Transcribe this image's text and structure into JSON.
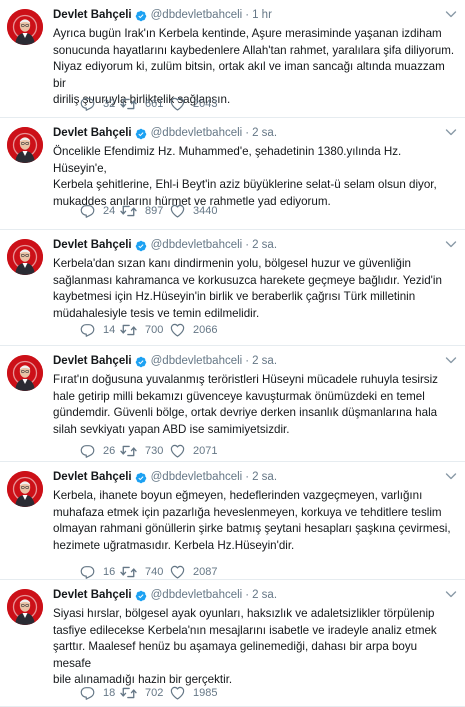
{
  "tweets": [
    {
      "name": "Devlet Bahçeli",
      "handle": "@dbdevletbahceli",
      "dot": "·",
      "time": "1 hr",
      "text": "Ayrıca bugün Irak'ın Kerbela kentinde, Aşure merasiminde yaşanan izdiham\nsonucunda hayatlarını kaybedenlere Allah'tan rahmet, yaralılara şifa diliyorum.\nNiyaz ediyorum ki, zulüm bitsin, ortak akıl ve iman sancağı altında muazzam bir\ndiriliş şuuruyla birliktelik sağlansın.",
      "replies": "32",
      "retweets": "661",
      "likes": "2043"
    },
    {
      "name": "Devlet Bahçeli",
      "handle": "@dbdevletbahceli",
      "dot": "·",
      "time": "2 sa.",
      "text": "Öncelikle Efendimiz Hz. Muhammed'e, şehadetinin 1380.yılında Hz. Hüseyin'e,\nKerbela şehitlerine, Ehl-i Beyt'in aziz büyüklerine selat-ü selam olsun diyor,\nmukaddes anılarını hürmet ve rahmetle yad ediyorum.",
      "replies": "24",
      "retweets": "897",
      "likes": "3440"
    },
    {
      "name": "Devlet Bahçeli",
      "handle": "@dbdevletbahceli",
      "dot": "·",
      "time": "2 sa.",
      "text": "Kerbela'dan sızan kanı dindirmenin yolu, bölgesel huzur ve güvenliğin\nsağlanması kahramanca ve korkusuzca harekete geçmeye bağlıdır. Yezid'in\nkaybetmesi için Hz.Hüseyin'in birlik ve beraberlik çağrısı Türk milletinin\nmüdahalesiyle tesis ve temin edilmelidir.",
      "replies": "14",
      "retweets": "700",
      "likes": "2066"
    },
    {
      "name": "Devlet Bahçeli",
      "handle": "@dbdevletbahceli",
      "dot": "·",
      "time": "2 sa.",
      "text": "Fırat'ın doğusuna yuvalanmış teröristleri Hüseyni mücadele ruhuyla tesirsiz\nhale getirip milli bekamızı güvenceye kavuşturmak önümüzdeki en temel\ngündemdir. Güvenli bölge, ortak devriye derken insanlık düşmanlarına hala\nsilah sevkiyatı yapan ABD ise samimiyetsizdir.",
      "replies": "26",
      "retweets": "730",
      "likes": "2071"
    },
    {
      "name": "Devlet Bahçeli",
      "handle": "@dbdevletbahceli",
      "dot": "·",
      "time": "2 sa.",
      "text": "Kerbela, ihanete boyun eğmeyen, hedeflerinden vazgeçmeyen, varlığını\nmuhafaza etmek için pazarlığa heveslenmeyen, korkuya ve tehditlere teslim\nolmayan rahmani gönüllerin şirke batmış şeytani hesapları şaşkına çevirmesi,\nhezimete uğratmasıdır. Kerbela Hz.Hüseyin'dir.",
      "replies": "16",
      "retweets": "740",
      "likes": "2087"
    },
    {
      "name": "Devlet Bahçeli",
      "handle": "@dbdevletbahceli",
      "dot": "·",
      "time": "2 sa.",
      "text": "Siyasi hırslar, bölgesel ayak oyunları, haksızlık ve adaletsizlikler törpülenip\ntasfiye edilecekse Kerbela'nın mesajlarını isabetle ve iradeyle analiz etmek\nşarttır. Maalesef henüz bu aşamaya gelinemediği, dahası bir arpa boyu mesafe\nbile alınamadığı hazin bir gerçektir.",
      "replies": "18",
      "retweets": "702",
      "likes": "1985"
    }
  ],
  "colors": {
    "text": "#14171a",
    "secondary": "#657786",
    "verified": "#1da1f2",
    "divider": "#e6ecf0",
    "avatar_bg": "#cc1018"
  },
  "icons": {
    "avatar": "avatar-image",
    "verified": "verified-badge-icon",
    "caret": "chevron-down-icon",
    "reply": "reply-icon",
    "retweet": "retweet-icon",
    "like": "heart-icon"
  }
}
